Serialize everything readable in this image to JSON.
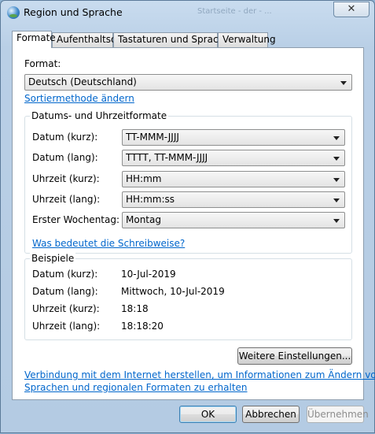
{
  "window": {
    "title": "Region und Sprache",
    "blurred_text": "Startseite - der - ... ",
    "close_glyph": "✕"
  },
  "tabs": [
    {
      "label": "Formate"
    },
    {
      "label": "Aufenthaltsort"
    },
    {
      "label": "Tastaturen und Sprachen"
    },
    {
      "label": "Verwaltung"
    }
  ],
  "format": {
    "label": "Format:",
    "value": "Deutsch (Deutschland)",
    "sort_link": "Sortiermethode ändern"
  },
  "datetime": {
    "title": "Datums- und Uhrzeitformate",
    "rows": [
      {
        "label": "Datum (kurz):",
        "value": "TT-MMM-JJJJ"
      },
      {
        "label": "Datum (lang):",
        "value": "TTTT, TT-MMM-JJJJ"
      },
      {
        "label": "Uhrzeit (kurz):",
        "value": "HH:mm"
      },
      {
        "label": "Uhrzeit (lang):",
        "value": "HH:mm:ss"
      },
      {
        "label": "Erster Wochentag:",
        "value": "Montag"
      }
    ],
    "notation_link": "Was bedeutet die Schreibweise?"
  },
  "examples": {
    "title": "Beispiele",
    "rows": [
      {
        "label": "Datum (kurz):",
        "value": "10-Jul-2019"
      },
      {
        "label": "Datum (lang):",
        "value": "Mittwoch, 10-Jul-2019"
      },
      {
        "label": "Uhrzeit (kurz):",
        "value": "18:18"
      },
      {
        "label": "Uhrzeit (lang):",
        "value": "18:18:20"
      }
    ]
  },
  "more_settings_button": "Weitere Einstellungen...",
  "internet_link": {
    "line1": "Verbindung mit dem Internet herstellen, um Informationen zum Ändern von",
    "line2": "Sprachen und regionalen Formaten zu erhalten"
  },
  "buttons": {
    "ok": "OK",
    "cancel": "Abbrechen",
    "apply": "Übernehmen"
  }
}
